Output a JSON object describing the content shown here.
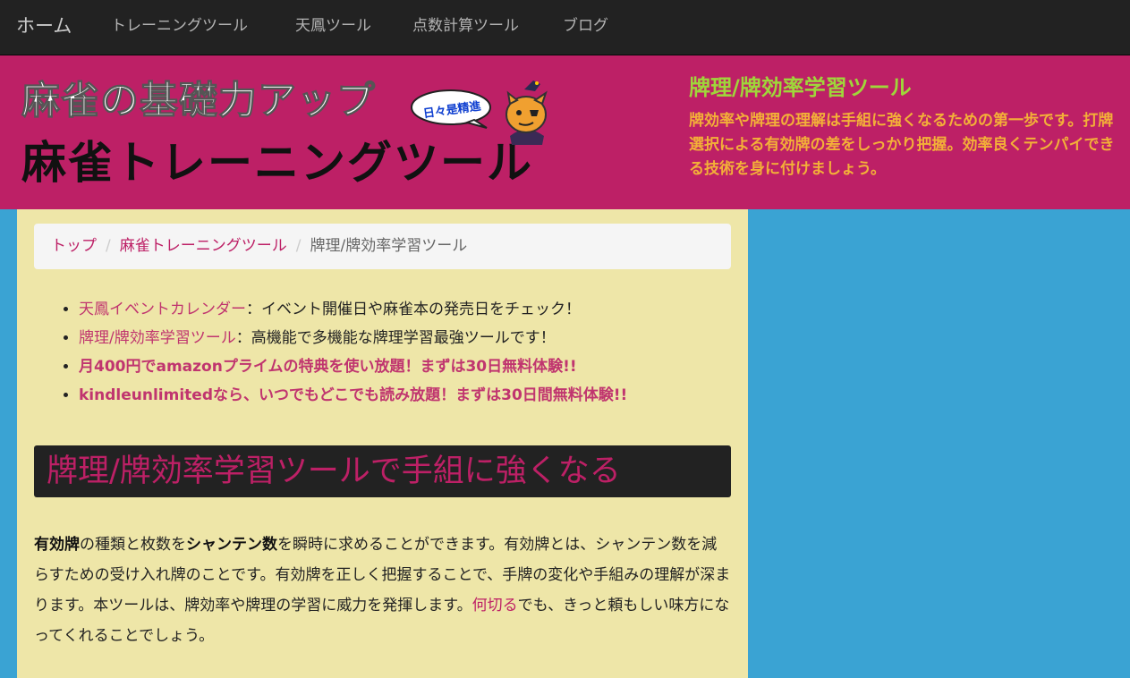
{
  "nav": {
    "brand": "ホーム",
    "links": [
      "トレーニングツール",
      "天鳳ツール",
      "点数計算ツール",
      "ブログ"
    ]
  },
  "header": {
    "banner_line1": "麻雀の基礎力アップ",
    "banner_line2": "麻雀トレーニングツール",
    "bubble_text": "日々是精進",
    "title": "牌理/牌効率学習ツール",
    "description": "牌効率や牌理の理解は手組に強くなるための第一歩です。打牌選択による有効牌の差をしっかり把握。効率良くテンパイできる技術を身に付けましょう。"
  },
  "breadcrumb": {
    "items": [
      "トップ",
      "麻雀トレーニングツール"
    ],
    "separator": "/",
    "current": "牌理/牌効率学習ツール"
  },
  "promos": [
    {
      "link": "天鳳イベントカレンダー",
      "text": "：イベント開催日や麻雀本の発売日をチェック！"
    },
    {
      "link": "牌理/牌効率学習ツール",
      "text": "：高機能で多機能な牌理学習最強ツールです！"
    },
    {
      "strong": "月400円でamazonプライムの特典を使い放題！まずは30日無料体験!!"
    },
    {
      "strong": "kindleunlimitedなら、いつでもどこでも読み放題！まずは30日間無料体験!!"
    }
  ],
  "section": {
    "heading": "牌理/牌効率学習ツールで手組に強くなる"
  },
  "intro": {
    "b1": "有効牌",
    "t1": "の種類と枚数を",
    "b2": "シャンテン数",
    "t2": "を瞬時に求めることができます。有効牌とは、シャンテン数を減らすための受け入れ牌のことです。有効牌を正しく把握することで、手牌の変化や手組みの理解が深まります。本ツールは、牌効率や牌理の学習に威力を発揮します。",
    "link": "何切る",
    "t3": "でも、きっと頼もしい味方になってくれることでしょう。"
  },
  "colors": {
    "navbar": "#222222",
    "header_bg": "#bd2066",
    "header_title": "#9fd63a",
    "header_desc": "#f3b038",
    "page_bg": "#3aa3d3",
    "main_bg": "#eee6a8",
    "accent": "#bd2066"
  }
}
